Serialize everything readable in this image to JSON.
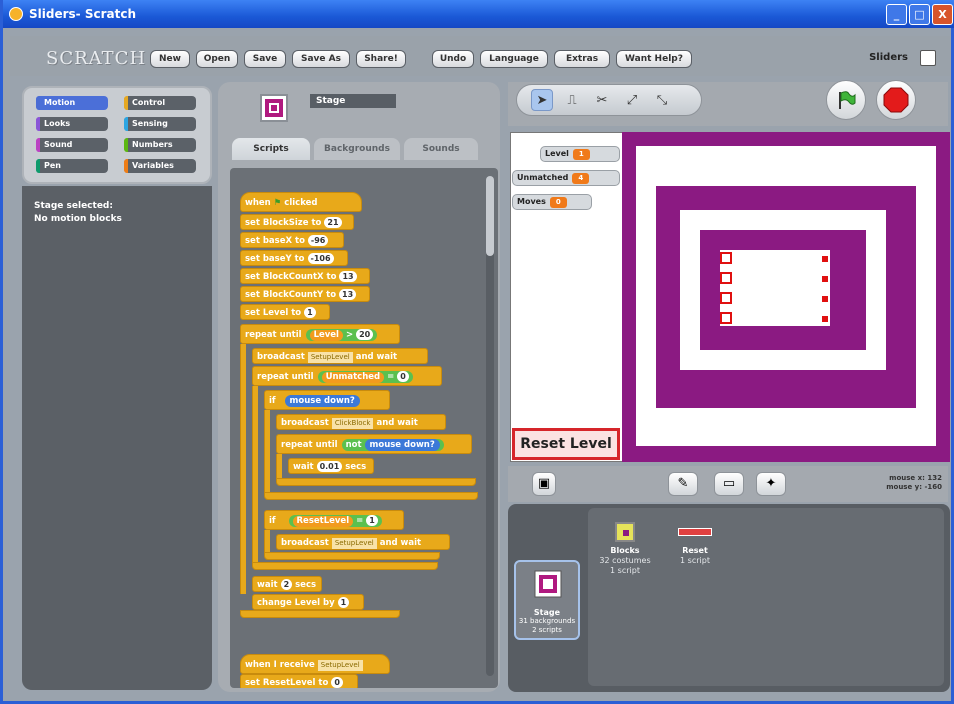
{
  "window": {
    "title": "Sliders- Scratch",
    "btn_min": "_",
    "btn_max": "□",
    "btn_close": "X"
  },
  "top": {
    "logo": "SCRATCH",
    "menu": [
      "New",
      "Open",
      "Save",
      "Save As",
      "Share!",
      "Undo",
      "Language",
      "Extras",
      "Want Help?"
    ],
    "project_name": "Sliders"
  },
  "categories": [
    {
      "label": "Motion",
      "color": "#4a6cd4",
      "selected": true
    },
    {
      "label": "Control",
      "color": "#e6a822"
    },
    {
      "label": "Looks",
      "color": "#8a55d7"
    },
    {
      "label": "Sensing",
      "color": "#2ca5e2"
    },
    {
      "label": "Sound",
      "color": "#bb42c3"
    },
    {
      "label": "Numbers",
      "color": "#5cb712"
    },
    {
      "label": "Pen",
      "color": "#0e9a6c"
    },
    {
      "label": "Variables",
      "color": "#ee7d16"
    }
  ],
  "palette": {
    "line1": "Stage selected:",
    "line2": "No motion blocks"
  },
  "sprite": {
    "name": "Stage"
  },
  "tabs": [
    "Scripts",
    "Backgrounds",
    "Sounds"
  ],
  "script": {
    "when_clicked": "when",
    "clicked": "clicked",
    "b1": "set BlockSize to",
    "b1v": "21",
    "b2": "set baseX to",
    "b2v": "-96",
    "b3": "set baseY to",
    "b3v": "-106",
    "b4": "set BlockCountX to",
    "b4v": "13",
    "b5": "set BlockCountY to",
    "b5v": "13",
    "b6": "set Level to",
    "b6v": "1",
    "repeat1": "repeat until",
    "r1var": "Level",
    "r1op": ">",
    "r1val": "20",
    "bc1": "broadcast",
    "bc1v": "SetupLevel",
    "and_wait": "and wait",
    "repeat2": "repeat until",
    "r2var": "Unmatched",
    "r2op": "=",
    "r2val": "0",
    "if1": "if",
    "mouse_down": "mouse down?",
    "bc2": "broadcast",
    "bc2v": "ClickBlock",
    "repeat3": "repeat until",
    "not": "not",
    "wait1": "wait",
    "wait1v": "0.01",
    "secs": "secs",
    "if2": "if",
    "if2var": "ResetLevel",
    "if2op": "=",
    "if2val": "1",
    "bc3": "broadcast",
    "bc3v": "SetupLevel",
    "wait2": "wait",
    "wait2v": "2",
    "change": "change Level by",
    "changev": "1",
    "when_recv": "when I receive",
    "recv_v": "SetupLevel",
    "set_reset": "set ResetLevel to",
    "set_reset_v": "0"
  },
  "monitors": [
    {
      "label": "Level",
      "value": "1"
    },
    {
      "label": "Unmatched",
      "value": "4"
    },
    {
      "label": "Moves",
      "value": "0"
    }
  ],
  "reset_label": "Reset Level",
  "mouse": {
    "x_label": "mouse x:",
    "x": "132",
    "y_label": "mouse y:",
    "y": "-160"
  },
  "sprites": [
    {
      "name": "Blocks",
      "l1": "32 costumes",
      "l2": "1 script"
    },
    {
      "name": "Reset",
      "l1": "",
      "l2": "1 script"
    }
  ],
  "stage_cell": {
    "name": "Stage",
    "l1": "31 backgrounds",
    "l2": "2 scripts"
  }
}
